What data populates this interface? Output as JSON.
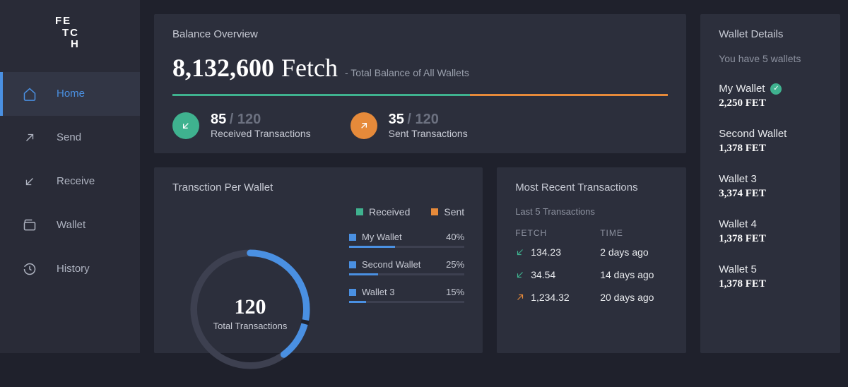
{
  "brand": {
    "line1": "FE",
    "line2": "TC",
    "line3": "H"
  },
  "nav": [
    {
      "label": "Home",
      "icon": "home-icon",
      "active": true
    },
    {
      "label": "Send",
      "icon": "send-icon",
      "active": false
    },
    {
      "label": "Receive",
      "icon": "receive-icon",
      "active": false
    },
    {
      "label": "Wallet",
      "icon": "wallet-icon",
      "active": false
    },
    {
      "label": "History",
      "icon": "history-icon",
      "active": false
    }
  ],
  "overview": {
    "title": "Balance Overview",
    "amount": "8,132,600",
    "unit": "Fetch",
    "subtitle": "- Total Balance of All Wallets",
    "bar_split": [
      60,
      40
    ],
    "received": {
      "num": "85",
      "den": "/ 120",
      "label": "Received Transactions"
    },
    "sent": {
      "num": "35",
      "den": "/ 120",
      "label": "Sent Transactions"
    }
  },
  "per_wallet": {
    "title": "Transction Per Wallet",
    "legend": [
      {
        "color": "green",
        "label": "Received"
      },
      {
        "color": "orange",
        "label": "Sent"
      }
    ],
    "donut": {
      "total": "120",
      "label": "Total Transactions"
    },
    "rows": [
      {
        "name": "My Wallet",
        "pct": "40%",
        "fill": 40
      },
      {
        "name": "Second Wallet",
        "pct": "25%",
        "fill": 25
      },
      {
        "name": "Wallet 3",
        "pct": "15%",
        "fill": 15
      }
    ]
  },
  "recent": {
    "title": "Most Recent Transactions",
    "subtitle": "Last 5 Transactions",
    "headers": {
      "c1": "FETCH",
      "c2": "TIME"
    },
    "rows": [
      {
        "dir": "in",
        "amount": "134.23",
        "time": "2 days ago"
      },
      {
        "dir": "in",
        "amount": "34.54",
        "time": "14 days ago"
      },
      {
        "dir": "out",
        "amount": "1,234.32",
        "time": "20 days ago"
      }
    ]
  },
  "details": {
    "title": "Wallet Details",
    "subtitle": "You have 5 wallets",
    "wallets": [
      {
        "name": "My Wallet",
        "amount": "2,250 FET",
        "verified": true
      },
      {
        "name": "Second Wallet",
        "amount": "1,378 FET",
        "verified": false
      },
      {
        "name": "Wallet 3",
        "amount": "3,374 FET",
        "verified": false
      },
      {
        "name": "Wallet 4",
        "amount": "1,378 FET",
        "verified": false
      },
      {
        "name": "Wallet 5",
        "amount": "1,378 FET",
        "verified": false
      }
    ]
  },
  "chart_data": {
    "type": "pie",
    "title": "Transction Per Wallet",
    "total": 120,
    "series": [
      {
        "name": "My Wallet",
        "value": 40
      },
      {
        "name": "Second Wallet",
        "value": 25
      },
      {
        "name": "Wallet 3",
        "value": 15
      }
    ]
  }
}
